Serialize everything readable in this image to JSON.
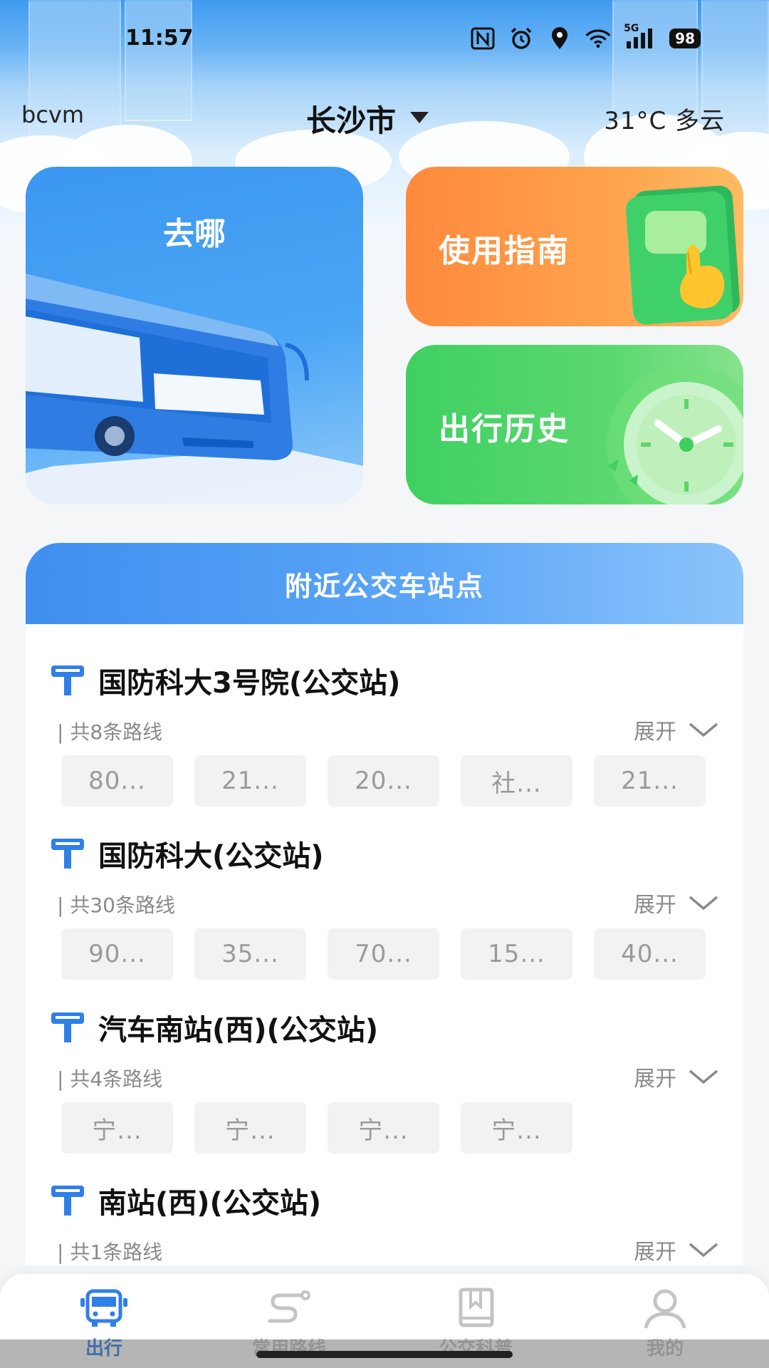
{
  "status_bar": {
    "time": "11:57",
    "battery": "98",
    "network": "5G",
    "icons": [
      "nfc-icon",
      "alarm-icon",
      "location-icon",
      "wifi-icon",
      "signal-icon",
      "battery-icon"
    ]
  },
  "header": {
    "user_name": "bcvm",
    "city": "长沙市",
    "weather": "31°C 多云"
  },
  "cards": {
    "go": "去哪",
    "guide": "使用指南",
    "history": "出行历史"
  },
  "nearby": {
    "title": "附近公交车站点",
    "expand_label": "展开",
    "stations": [
      {
        "name": "国防科大3号院(公交站)",
        "route_count": "| 共8条路线",
        "routes": [
          "80...",
          "21...",
          "20...",
          "社...",
          "21..."
        ]
      },
      {
        "name": "国防科大(公交站)",
        "route_count": "| 共30条路线",
        "routes": [
          "90...",
          "35...",
          "70...",
          "15...",
          "40..."
        ]
      },
      {
        "name": "汽车南站(西)(公交站)",
        "route_count": "| 共4条路线",
        "routes": [
          "宁...",
          "宁...",
          "宁...",
          "宁..."
        ]
      },
      {
        "name": "南站(西)(公交站)",
        "route_count": "| 共1条路线",
        "routes": []
      }
    ]
  },
  "bottom_nav": {
    "items": [
      {
        "label": "出行",
        "icon": "bus-icon",
        "active": true
      },
      {
        "label": "常用路线",
        "icon": "route-icon",
        "active": false
      },
      {
        "label": "公交科普",
        "icon": "book-icon",
        "active": false
      },
      {
        "label": "我的",
        "icon": "user-icon",
        "active": false
      }
    ]
  },
  "colors": {
    "accent": "#2f7fe8",
    "guide_card": "#ff9a45",
    "history_card": "#4fd466",
    "nearby_header": "#4f9cf5"
  }
}
